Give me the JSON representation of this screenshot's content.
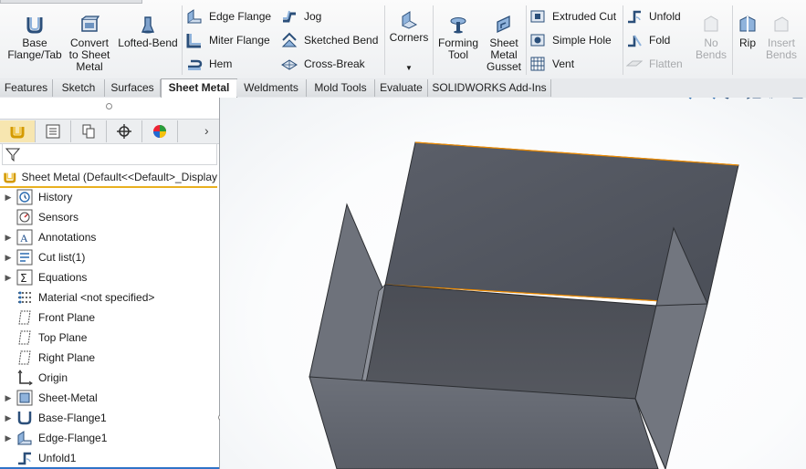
{
  "ribbon": {
    "base_flange": "Base\nFlange/Tab",
    "convert": "Convert\nto Sheet\nMetal",
    "lofted": "Lofted-Bend",
    "edge_flange": "Edge Flange",
    "miter_flange": "Miter Flange",
    "hem": "Hem",
    "jog": "Jog",
    "sketched_bend": "Sketched Bend",
    "cross_break": "Cross-Break",
    "corners": "Corners",
    "forming_tool": "Forming\nTool",
    "gusset": "Sheet\nMetal\nGusset",
    "extruded_cut": "Extruded Cut",
    "simple_hole": "Simple Hole",
    "vent": "Vent",
    "unfold": "Unfold",
    "fold": "Fold",
    "flatten": "Flatten",
    "no_bends": "No\nBends",
    "rip": "Rip",
    "insert_bends": "Insert\nBends"
  },
  "tabs": [
    "Features",
    "Sketch",
    "Surfaces",
    "Sheet Metal",
    "Weldments",
    "Mold Tools",
    "Evaluate",
    "SOLIDWORKS Add-Ins"
  ],
  "active_tab": "Sheet Metal",
  "tree": {
    "root": "Sheet Metal  (Default<<Default>_Display",
    "items": [
      {
        "label": "History",
        "icon": "history-icon",
        "expandable": true
      },
      {
        "label": "Sensors",
        "icon": "sensors-icon",
        "expandable": false
      },
      {
        "label": "Annotations",
        "icon": "annotations-icon",
        "expandable": true
      },
      {
        "label": "Cut list(1)",
        "icon": "cut-list-icon",
        "expandable": true
      },
      {
        "label": "Equations",
        "icon": "equations-icon",
        "expandable": true
      },
      {
        "label": "Material <not specified>",
        "icon": "material-icon",
        "expandable": false
      },
      {
        "label": "Front Plane",
        "icon": "plane-icon",
        "expandable": false
      },
      {
        "label": "Top Plane",
        "icon": "plane-icon",
        "expandable": false
      },
      {
        "label": "Right Plane",
        "icon": "plane-icon",
        "expandable": false
      },
      {
        "label": "Origin",
        "icon": "origin-icon",
        "expandable": false
      },
      {
        "label": "Sheet-Metal",
        "icon": "sheet-metal-feature-icon",
        "expandable": true
      },
      {
        "label": "Base-Flange1",
        "icon": "base-flange-icon",
        "expandable": true
      },
      {
        "label": "Edge-Flange1",
        "icon": "edge-flange-icon",
        "expandable": true
      },
      {
        "label": "Unfold1",
        "icon": "unfold-icon",
        "expandable": false
      }
    ]
  },
  "colors": {
    "accent": "#e8b020",
    "selection_blue": "#2f73c8",
    "model_face": "#6b7280",
    "edge_highlight": "#f08c00"
  }
}
